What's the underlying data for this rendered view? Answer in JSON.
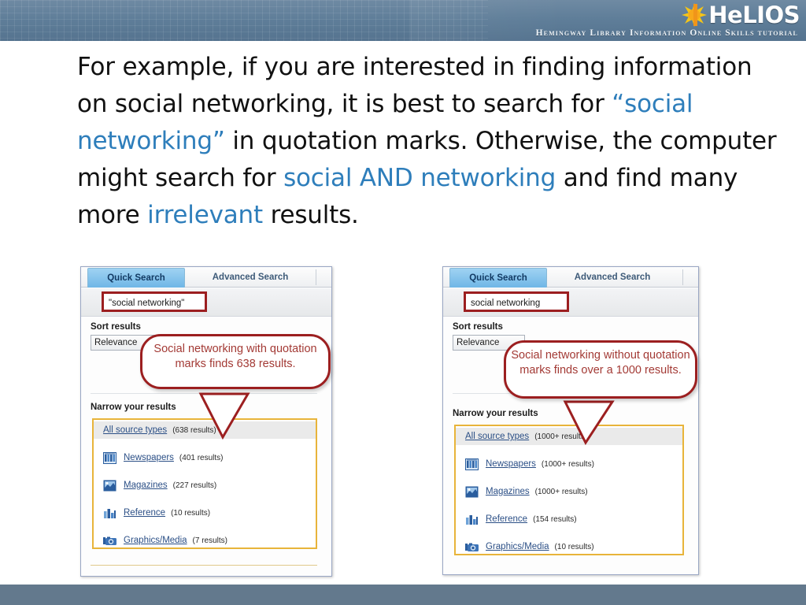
{
  "header": {
    "logo_text": "HeLIOS",
    "logo_icon": "sun-icon",
    "tagline": "Hemingway Library Information Online Skills tutorial"
  },
  "slide": {
    "text_parts": [
      {
        "text": "For example, if you are interested in finding information on social networking, it is best to search for ",
        "style": "plain"
      },
      {
        "text": "“social networking”",
        "style": "highlight"
      },
      {
        "text": " in quotation marks. Otherwise, the computer might search for ",
        "style": "plain"
      },
      {
        "text": "social AND networking",
        "style": "highlight"
      },
      {
        "text": " and find many more ",
        "style": "plain"
      },
      {
        "text": "irrelevant",
        "style": "highlight"
      },
      {
        "text": " results.",
        "style": "plain"
      }
    ],
    "p1": "For example, if you are interested in finding information on social networking, it is best to search for ",
    "p2": "“social networking”",
    "p3": " in quotation marks. Otherwise, the computer might search for ",
    "p4": "social AND networking",
    "p5": " and find many more ",
    "p6": "irrelevant",
    "p7": " results."
  },
  "colors": {
    "highlight_blue": "#2e7ebb",
    "header_blue": "#5f7e99",
    "footer_blue": "#63798d",
    "callout_red": "#9c1f20",
    "callout_text": "#a33a35",
    "results_border_gold": "#e8b43a",
    "tab_active_blue": "#6fb6e6",
    "link_blue": "#2b4f86"
  },
  "left_panel": {
    "tabs": [
      {
        "label": "Quick Search",
        "active": true
      },
      {
        "label": "Advanced Search",
        "active": false
      }
    ],
    "search_value": "\"social networking\"",
    "sort_label": "Sort results",
    "sort_value": "Relevance",
    "narrow_title": "Narrow your results",
    "results": [
      {
        "icon": "none",
        "label": "All source types",
        "count": "(638 results)",
        "selected": true
      },
      {
        "icon": "newspaper-icon",
        "label": "Newspapers",
        "count": "(401 results)",
        "selected": false
      },
      {
        "icon": "magazine-icon",
        "label": "Magazines",
        "count": "(227 results)",
        "selected": false
      },
      {
        "icon": "reference-icon",
        "label": "Reference",
        "count": "(10 results)",
        "selected": false
      },
      {
        "icon": "camera-icon",
        "label": "Graphics/Media",
        "count": "(7 results)",
        "selected": false
      }
    ],
    "callout": "Social networking with quotation marks finds 638 results."
  },
  "right_panel": {
    "tabs": [
      {
        "label": "Quick Search",
        "active": true
      },
      {
        "label": "Advanced Search",
        "active": false
      }
    ],
    "search_value": "social networking",
    "sort_label": "Sort results",
    "sort_value": "Relevance",
    "narrow_title": "Narrow your results",
    "results": [
      {
        "icon": "none",
        "label": "All source types",
        "count": "(1000+ results)",
        "selected": true
      },
      {
        "icon": "newspaper-icon",
        "label": "Newspapers",
        "count": "(1000+ results)",
        "selected": false
      },
      {
        "icon": "magazine-icon",
        "label": "Magazines",
        "count": "(1000+ results)",
        "selected": false
      },
      {
        "icon": "reference-icon",
        "label": "Reference",
        "count": "(154 results)",
        "selected": false
      },
      {
        "icon": "camera-icon",
        "label": "Graphics/Media",
        "count": "(10 results)",
        "selected": false
      }
    ],
    "callout": "Social networking without quotation marks finds over a 1000 results."
  }
}
